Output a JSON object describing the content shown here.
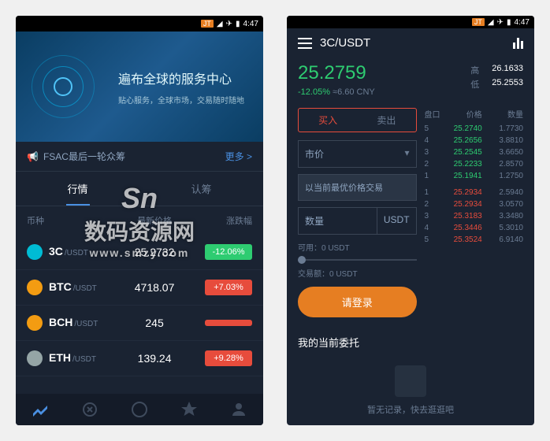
{
  "status": {
    "time": "4:47",
    "badge": "JT"
  },
  "screen1": {
    "hero": {
      "title": "遍布全球的服务中心",
      "subtitle": "贴心服务，全球市场，交易随时随地"
    },
    "announce": {
      "text": "FSAC最后一轮众筹",
      "more": "更多 >"
    },
    "tabs": {
      "market": "行情",
      "subscribe": "认筹"
    },
    "columns": {
      "coin": "币种",
      "price": "最新价格",
      "change": "涨跌幅"
    },
    "coins": [
      {
        "sym": "3C",
        "quote": "/USDT",
        "price": "25.2732",
        "chg": "-12.06%",
        "dir": "neg",
        "color": "#00bcd4"
      },
      {
        "sym": "BTC",
        "quote": "/USDT",
        "price": "4718.07",
        "chg": "+7.03%",
        "dir": "pos",
        "color": "#f39c12"
      },
      {
        "sym": "BCH",
        "quote": "/USDT",
        "price": "245",
        "chg": "",
        "dir": "pos",
        "color": "#f39c12"
      },
      {
        "sym": "ETH",
        "quote": "/USDT",
        "price": "139.24",
        "chg": "+9.28%",
        "dir": "pos",
        "color": "#95a5a6"
      }
    ]
  },
  "screen2": {
    "pair": "3C/USDT",
    "price": "25.2759",
    "change_pct": "-12.05%",
    "change_cny": "≈6.60 CNY",
    "high_label": "高",
    "high": "26.1633",
    "low_label": "低",
    "low": "25.2553",
    "buy_tab": "买入",
    "sell_tab": "卖出",
    "ob_cols": {
      "pan": "盘口",
      "price": "价格",
      "qty": "数量"
    },
    "price_type": "市价",
    "price_hint": "以当前最优价格交易",
    "qty_label": "数量",
    "qty_unit": "USDT",
    "avail": "可用：0 USDT",
    "amount": "交易额：0 USDT",
    "login": "请登录",
    "asks": [
      {
        "i": "5",
        "p": "25.2740",
        "q": "1.7730"
      },
      {
        "i": "4",
        "p": "25.2656",
        "q": "3.8810"
      },
      {
        "i": "3",
        "p": "25.2545",
        "q": "3.6650"
      },
      {
        "i": "2",
        "p": "25.2233",
        "q": "2.8570"
      },
      {
        "i": "1",
        "p": "25.1941",
        "q": "1.2750"
      }
    ],
    "bids": [
      {
        "i": "1",
        "p": "25.2934",
        "q": "2.5940"
      },
      {
        "i": "2",
        "p": "25.2934",
        "q": "3.0570"
      },
      {
        "i": "3",
        "p": "25.3183",
        "q": "3.3480"
      },
      {
        "i": "4",
        "p": "25.3446",
        "q": "5.3010"
      },
      {
        "i": "5",
        "p": "25.3524",
        "q": "6.9140"
      }
    ],
    "orders_title": "我的当前委托",
    "empty": "暂无记录，快去逛逛吧"
  },
  "watermark": {
    "main": "数码资源网",
    "sub": "www.smzy.com"
  }
}
